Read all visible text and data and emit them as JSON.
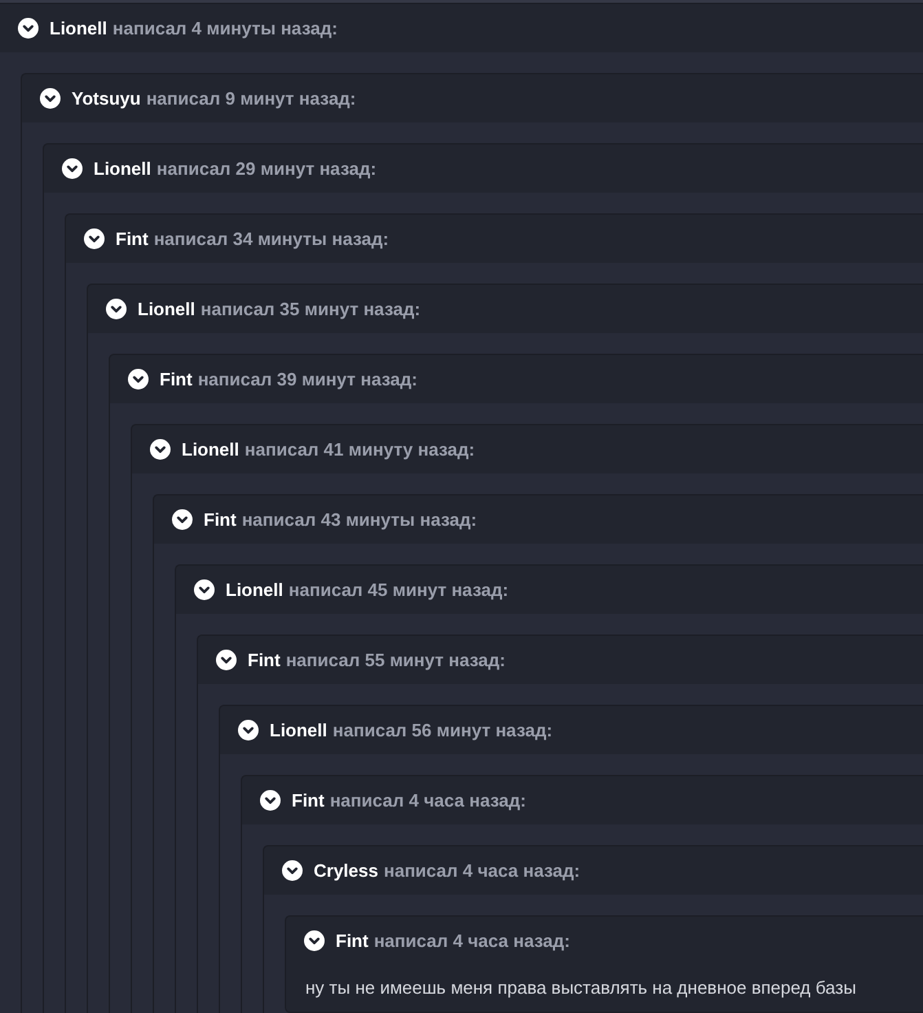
{
  "thread": [
    {
      "author": "Lionell",
      "meta": "написал 4 минуты назад:",
      "expanded": true,
      "replies": [
        {
          "author": "Yotsuyu",
          "meta": "написал 9 минут назад:",
          "expanded": true,
          "replies": [
            {
              "author": "Lionell",
              "meta": "написал 29 минут назад:",
              "expanded": true,
              "replies": [
                {
                  "author": "Fint",
                  "meta": "написал 34 минуты назад:",
                  "expanded": true,
                  "replies": [
                    {
                      "author": "Lionell",
                      "meta": "написал 35 минут назад:",
                      "expanded": true,
                      "replies": [
                        {
                          "author": "Fint",
                          "meta": "написал 39 минут назад:",
                          "expanded": true,
                          "replies": [
                            {
                              "author": "Lionell",
                              "meta": "написал 41 минуту назад:",
                              "expanded": true,
                              "replies": [
                                {
                                  "author": "Fint",
                                  "meta": "написал 43 минуты назад:",
                                  "expanded": true,
                                  "replies": [
                                    {
                                      "author": "Lionell",
                                      "meta": "написал 45 минут назад:",
                                      "expanded": true,
                                      "replies": [
                                        {
                                          "author": "Fint",
                                          "meta": "написал 55 минут назад:",
                                          "expanded": true,
                                          "replies": [
                                            {
                                              "author": "Lionell",
                                              "meta": "написал 56 минут назад:",
                                              "expanded": true,
                                              "replies": [
                                                {
                                                  "author": "Fint",
                                                  "meta": "написал 4 часа назад:",
                                                  "expanded": true,
                                                  "replies": [
                                                    {
                                                      "author": "Cryless",
                                                      "meta": "написал 4 часа назад:",
                                                      "expanded": true,
                                                      "replies": [
                                                        {
                                                          "author": "Fint",
                                                          "meta": "написал 4 часа назад:",
                                                          "expanded": true,
                                                          "text": "ну ты не имеешь меня права выставлять на дневное вперед базы"
                                                        }
                                                      ]
                                                    }
                                                  ]
                                                }
                                              ]
                                            }
                                          ]
                                        }
                                      ]
                                    }
                                  ]
                                }
                              ]
                            }
                          ]
                        }
                      ]
                    }
                  ]
                }
              ]
            }
          ]
        }
      ]
    }
  ]
}
